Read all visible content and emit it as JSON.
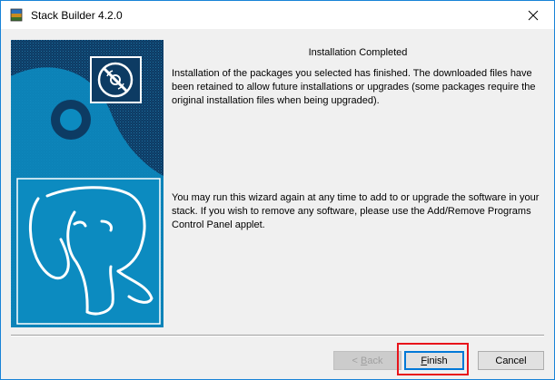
{
  "window": {
    "title": "Stack Builder 4.2.0",
    "app_icon": "stack-builder-icon",
    "close_icon": "close-icon"
  },
  "page": {
    "heading": "Installation Completed",
    "paragraph1": "Installation of the packages you selected has finished. The downloaded files have been retained to allow future installations or upgrades (some packages require the original installation files when being upgraded).",
    "paragraph2": "You may run this wizard again at any time to add to or upgrade the software in your stack. If you wish to remove any software, please use the Add/Remove Programs Control Panel applet."
  },
  "buttons": {
    "back": {
      "prefix": "< ",
      "mnemonic": "B",
      "rest": "ack",
      "enabled": false
    },
    "finish": {
      "prefix": "",
      "mnemonic": "F",
      "rest": "inish",
      "enabled": true
    },
    "cancel": {
      "label": "Cancel",
      "enabled": true
    }
  },
  "colors": {
    "banner_blue": "#0c8bc0",
    "banner_dark": "#11385a",
    "highlight": "#e8141b"
  }
}
